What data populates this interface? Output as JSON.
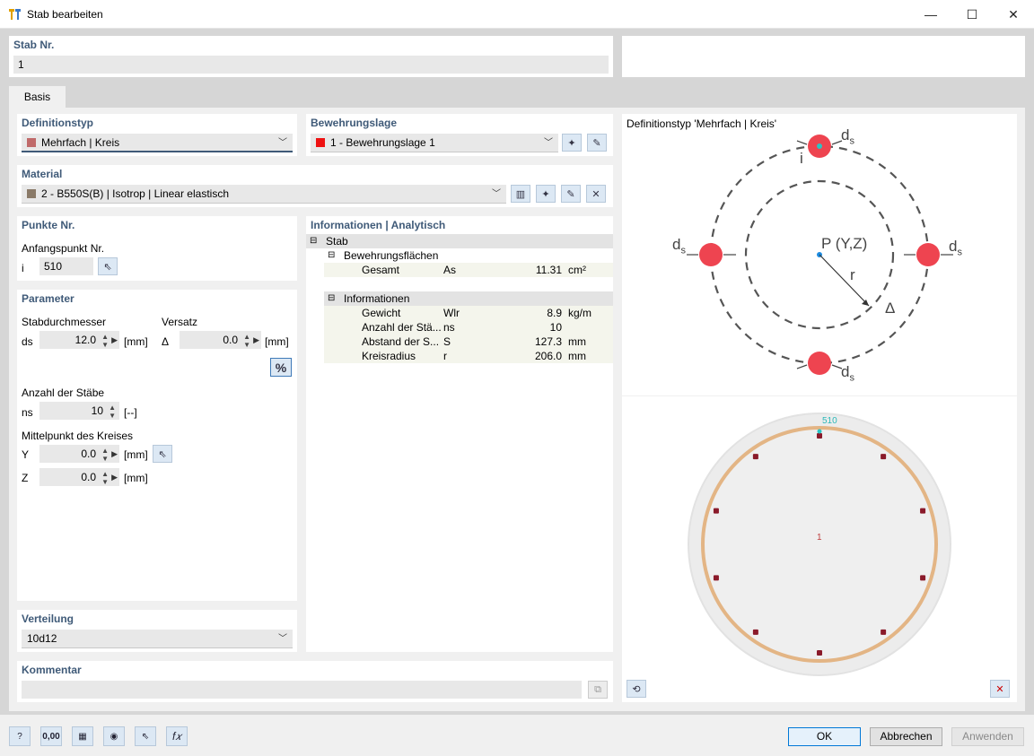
{
  "window": {
    "title": "Stab bearbeiten",
    "min": "—",
    "max": "☐",
    "close": "✕"
  },
  "stab_nr": {
    "label": "Stab Nr.",
    "value": "1"
  },
  "tabs": [
    {
      "label": "Basis"
    }
  ],
  "definitionstyp": {
    "label": "Definitionstyp",
    "value": "Mehrfach | Kreis",
    "color": "#c06a6a"
  },
  "bewehrungslage": {
    "label": "Bewehrungslage",
    "value": "1 - Bewehrungslage 1",
    "color": "#ee1111"
  },
  "material": {
    "label": "Material",
    "value": "2 - B550S(B) | Isotrop | Linear elastisch",
    "color": "#8a7a68"
  },
  "punkte": {
    "label": "Punkte Nr.",
    "anfangspunkt_label": "Anfangspunkt Nr.",
    "i_label": "i",
    "i_value": "510"
  },
  "parameter": {
    "label": "Parameter",
    "stabdurchmesser_label": "Stabdurchmesser",
    "ds_label": "ds",
    "ds_value": "12.0",
    "ds_unit": "[mm]",
    "versatz_label": "Versatz",
    "delta_label": "Δ",
    "delta_value": "0.0",
    "delta_unit": "[mm]",
    "percent": "%",
    "anzahl_label": "Anzahl der Stäbe",
    "ns_label": "ns",
    "ns_value": "10",
    "ns_unit": "[--]",
    "mittelpunkt_label": "Mittelpunkt des Kreises",
    "y_label": "Y",
    "y_value": "0.0",
    "y_unit": "[mm]",
    "z_label": "Z",
    "z_value": "0.0",
    "z_unit": "[mm]"
  },
  "verteilung": {
    "label": "Verteilung",
    "value": "10d12"
  },
  "kommentar": {
    "label": "Kommentar",
    "value": ""
  },
  "info": {
    "label": "Informationen | Analytisch",
    "root": "Stab",
    "group1": "Bewehrungsflächen",
    "rows1": [
      {
        "name": "Gesamt",
        "sym": "As",
        "value": "11.31",
        "unit": "cm²"
      }
    ],
    "group2": "Informationen",
    "rows2": [
      {
        "name": "Gewicht",
        "sym": "Wlr",
        "value": "8.9",
        "unit": "kg/m"
      },
      {
        "name": "Anzahl der Stä...",
        "sym": "ns",
        "value": "10",
        "unit": ""
      },
      {
        "name": "Abstand der S...",
        "sym": "S",
        "value": "127.3",
        "unit": "mm"
      },
      {
        "name": "Kreisradius",
        "sym": "r",
        "value": "206.0",
        "unit": "mm"
      }
    ]
  },
  "diagram": {
    "title": "Definitionstyp 'Mehrfach | Kreis'",
    "label_p": "P (Y,Z)",
    "label_r": "r",
    "label_delta": "Δ",
    "label_i": "i",
    "label_ds": "d",
    "label_ds_sub": "s"
  },
  "preview": {
    "point_label": "510",
    "member_label": "1",
    "bar_count": 10
  },
  "buttons": {
    "ok": "OK",
    "cancel": "Abbrechen",
    "apply": "Anwenden"
  },
  "toolbar_icons": [
    "help-icon",
    "units-icon",
    "section-icon",
    "view-icon",
    "select-icon",
    "formula-icon"
  ],
  "toolbar_text": {
    "units": "0,00",
    "formula": "f𝑥"
  }
}
